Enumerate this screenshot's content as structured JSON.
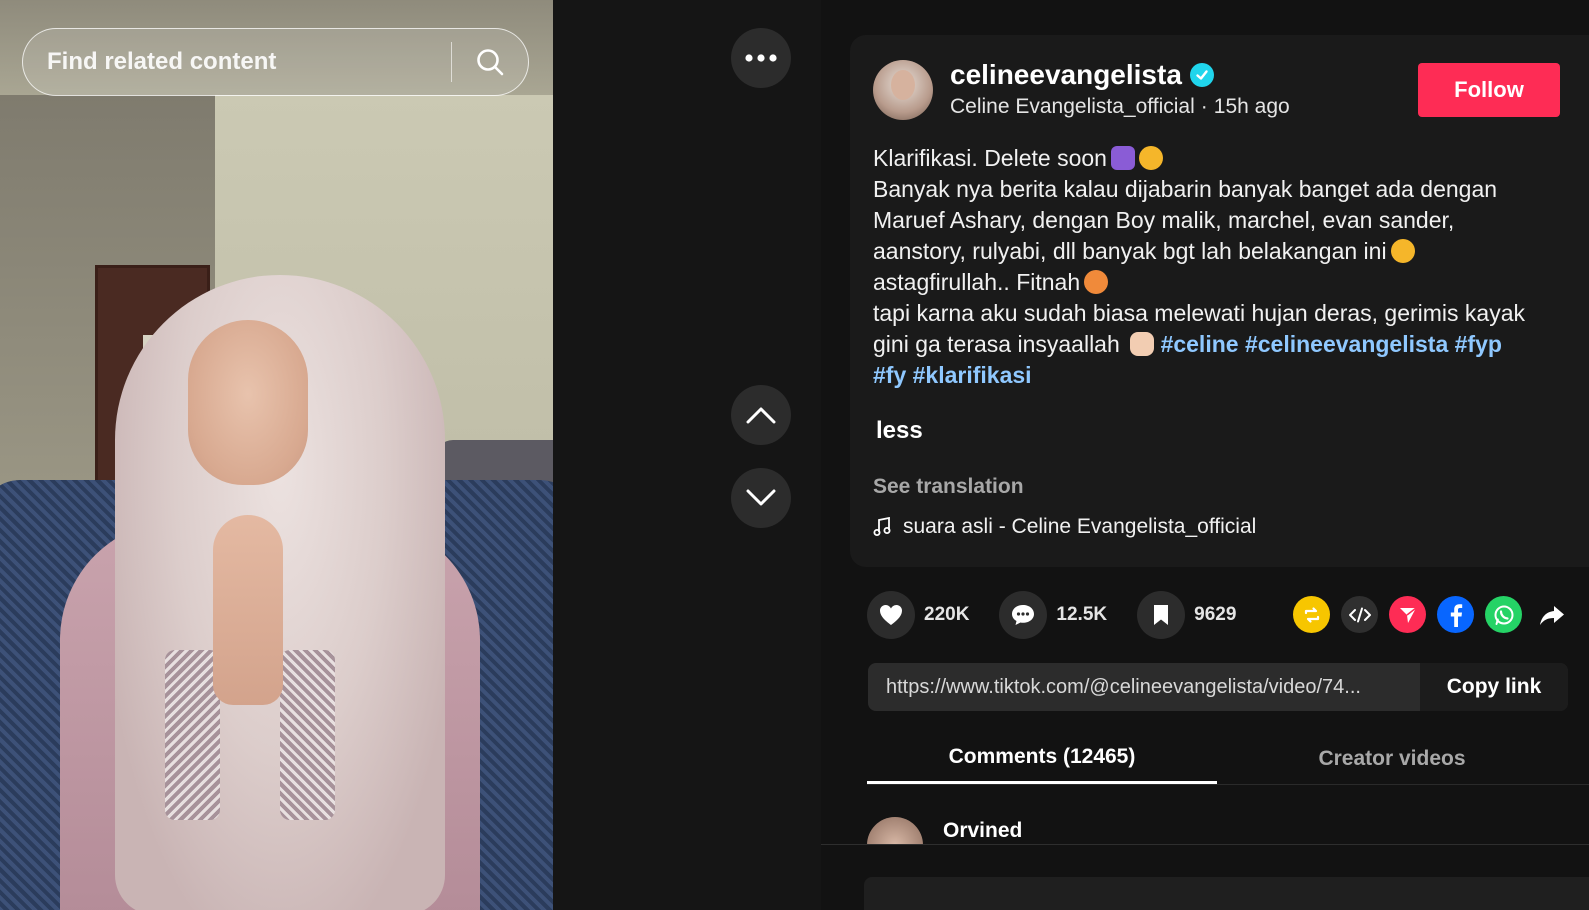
{
  "search": {
    "placeholder": "Find related content"
  },
  "post": {
    "username": "celineevangelista",
    "display_name": "Celine Evangelista_official",
    "separator": "·",
    "time_ago": "15h ago",
    "follow_label": "Follow",
    "description_lines": [
      "Klarifikasi. Delete soon",
      "Banyak nya berita kalau dijabarin banyak banget ada dengan",
      "Maruef Ashary, dengan Boy malik, marchel, evan sander,",
      "aanstory, rulyabi, dll banyak bgt lah belakangan ini",
      "astagfirullah.. Fitnah",
      "tapi karna aku sudah biasa melewati hujan deras, gerimis kayak",
      "gini ga terasa insyaallah"
    ],
    "hashtags": [
      "#celine",
      "#celineevangelista",
      "#fyp",
      "#fy",
      "#klarifikasi"
    ],
    "less_label": "less",
    "see_translation": "See translation",
    "sound": "suara asli - Celine Evangelista_official"
  },
  "stats": {
    "likes": "220K",
    "comments": "12.5K",
    "saves": "9629"
  },
  "share": {
    "icons": [
      "repost-icon",
      "embed-icon",
      "send-icon",
      "facebook-icon",
      "whatsapp-icon",
      "share-arrow-icon"
    ],
    "colors": {
      "repost": "#f7c600",
      "embed": "#2f2f2f",
      "send": "#fe2c55",
      "facebook": "#0866ff",
      "whatsapp": "#25d366"
    }
  },
  "link": {
    "url": "https://www.tiktok.com/@celineevangelista/video/74...",
    "copy_label": "Copy link"
  },
  "tabs": [
    {
      "label": "Comments (12465)",
      "active": true
    },
    {
      "label": "Creator videos",
      "active": false
    }
  ],
  "comments": [
    {
      "author": "Orvined"
    }
  ],
  "colors": {
    "accent": "#fe2c55",
    "hashtag": "#8fc8ff",
    "verified": "#20d5ec",
    "background": "#121212"
  }
}
